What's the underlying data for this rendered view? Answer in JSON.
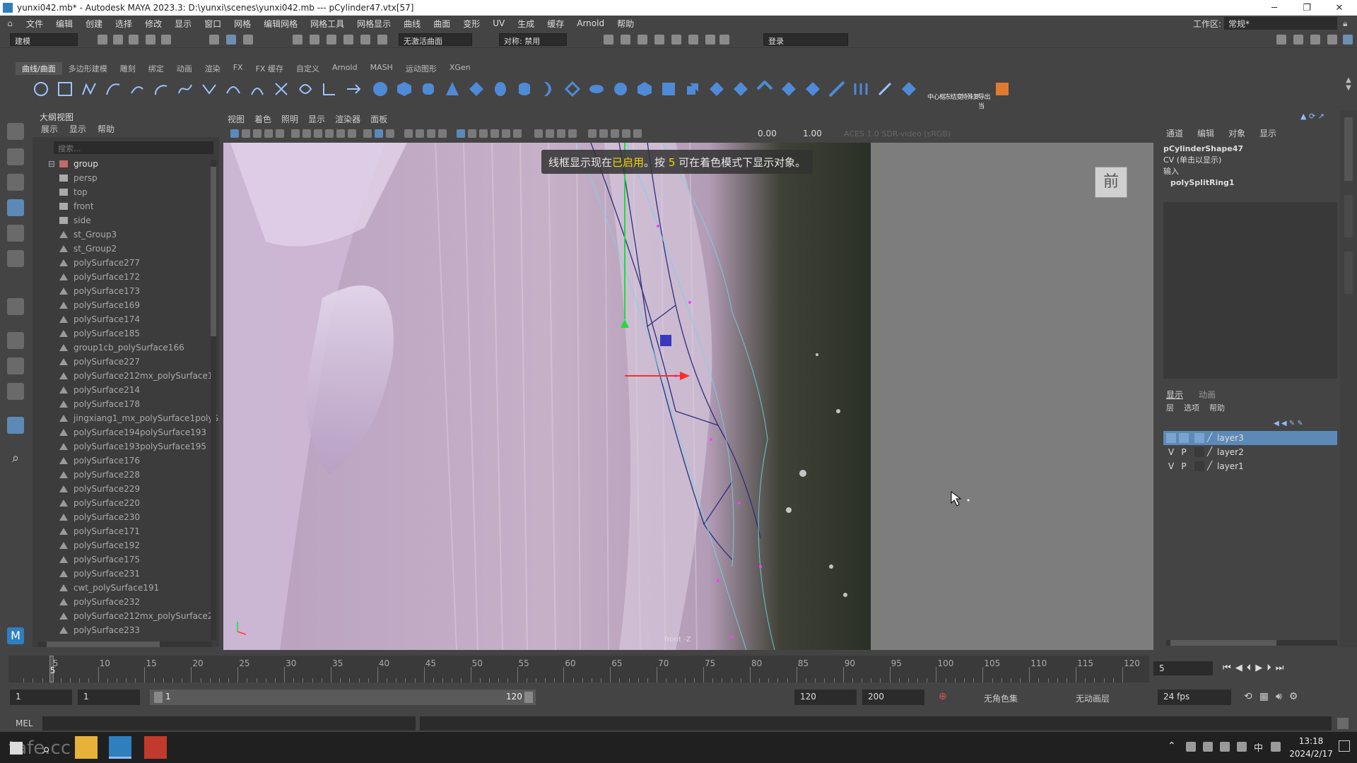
{
  "window": {
    "title": "yunxi042.mb* - Autodesk MAYA 2023.3: D:\\yunxi\\scenes\\yunxi042.mb   ---   pCylinder47.vtx[57]",
    "minimize": "─",
    "maximize": "❐",
    "close": "✕"
  },
  "menubar": [
    "文件",
    "编辑",
    "创建",
    "选择",
    "修改",
    "显示",
    "窗口",
    "网格",
    "编辑网格",
    "网格工具",
    "网格显示",
    "曲线",
    "曲面",
    "变形",
    "UV",
    "生成",
    "缓存",
    "Arnold",
    "帮助"
  ],
  "workspace": {
    "label": "工作区:",
    "value": "常规*"
  },
  "statusline": {
    "mode": "建模",
    "live_surface": "无激活曲面",
    "symmetry": "对称: 禁用",
    "login": "登录"
  },
  "shelf": {
    "tabs": [
      "曲线/曲面",
      "多边形建模",
      "雕刻",
      "绑定",
      "动画",
      "渲染",
      "FX",
      "FX 缓存",
      "自定义",
      "Arnold",
      "MASH",
      "运动图形",
      "XGen"
    ],
    "active": "曲线/曲面",
    "labels": [
      "中心枢",
      "冻结变",
      "特殊复",
      "导出当"
    ]
  },
  "outliner": {
    "title": "大纲视图",
    "menu": [
      "展示",
      "显示",
      "帮助"
    ],
    "search_placeholder": "搜索...",
    "items": [
      {
        "label": "group",
        "type": "group"
      },
      {
        "label": "persp",
        "type": "camera"
      },
      {
        "label": "top",
        "type": "camera"
      },
      {
        "label": "front",
        "type": "camera"
      },
      {
        "label": "side",
        "type": "camera"
      },
      {
        "label": "st_Group3",
        "type": "mesh"
      },
      {
        "label": "st_Group2",
        "type": "mesh"
      },
      {
        "label": "polySurface277",
        "type": "mesh"
      },
      {
        "label": "polySurface172",
        "type": "mesh"
      },
      {
        "label": "polySurface173",
        "type": "mesh"
      },
      {
        "label": "polySurface169",
        "type": "mesh"
      },
      {
        "label": "polySurface174",
        "type": "mesh"
      },
      {
        "label": "polySurface185",
        "type": "mesh"
      },
      {
        "label": "group1cb_polySurface166",
        "type": "mesh"
      },
      {
        "label": "polySurface227",
        "type": "mesh"
      },
      {
        "label": "polySurface212mx_polySurface1",
        "type": "mesh"
      },
      {
        "label": "polySurface214",
        "type": "mesh"
      },
      {
        "label": "polySurface178",
        "type": "mesh"
      },
      {
        "label": "jingxiang1_mx_polySurface1polyS",
        "type": "mesh"
      },
      {
        "label": "polySurface194polySurface193",
        "type": "mesh"
      },
      {
        "label": "polySurface193polySurface195",
        "type": "mesh"
      },
      {
        "label": "polySurface176",
        "type": "mesh"
      },
      {
        "label": "polySurface228",
        "type": "mesh"
      },
      {
        "label": "polySurface229",
        "type": "mesh"
      },
      {
        "label": "polySurface220",
        "type": "mesh"
      },
      {
        "label": "polySurface230",
        "type": "mesh"
      },
      {
        "label": "polySurface171",
        "type": "mesh"
      },
      {
        "label": "polySurface192",
        "type": "mesh"
      },
      {
        "label": "polySurface175",
        "type": "mesh"
      },
      {
        "label": "polySurface231",
        "type": "mesh"
      },
      {
        "label": "cwt_polySurface191",
        "type": "mesh"
      },
      {
        "label": "polySurface232",
        "type": "mesh"
      },
      {
        "label": "polySurface212mx_polySurface2",
        "type": "mesh"
      },
      {
        "label": "polySurface233",
        "type": "mesh"
      }
    ]
  },
  "viewport": {
    "menu": [
      "视图",
      "着色",
      "照明",
      "显示",
      "渲染器",
      "面板"
    ],
    "exposure": "0.00",
    "gamma": "1.00",
    "colorspace": "ACES 1.0 SDR-video (sRGB)",
    "hint_pre": "线框显示现在",
    "hint_hl1": "已启用",
    "hint_mid": "。按 ",
    "hint_hl2": "5",
    "hint_post": " 可在着色模式下显示对象。",
    "view_cube": "前",
    "camera_label": "front -Z"
  },
  "channelbox": {
    "menu": [
      "通道",
      "编辑",
      "对象",
      "显示"
    ],
    "shape": "pCylinderShape47",
    "cv_note": "CV (单击以显示)",
    "inputs_label": "输入",
    "input_node": "polySplitRing1"
  },
  "layers": {
    "tabs": [
      "显示",
      "动画"
    ],
    "menu": [
      "层",
      "选项",
      "帮助"
    ],
    "rows": [
      {
        "v": "",
        "p": "",
        "name": "layer3",
        "selected": true
      },
      {
        "v": "V",
        "p": "P",
        "name": "layer2",
        "selected": false
      },
      {
        "v": "V",
        "p": "P",
        "name": "layer1",
        "selected": false
      }
    ]
  },
  "timeslider": {
    "ticks": [
      "5",
      "10",
      "15",
      "20",
      "25",
      "30",
      "35",
      "40",
      "45",
      "50",
      "55",
      "60",
      "65",
      "70",
      "75",
      "80",
      "85",
      "90",
      "95",
      "100",
      "105",
      "110",
      "115",
      "120"
    ],
    "current_frame": "5"
  },
  "range": {
    "start": "1",
    "anim_start": "1",
    "slider_start": "1",
    "slider_end": "120",
    "end": "120",
    "anim_end": "200",
    "char_set": "无角色集",
    "anim_layer": "无动画层",
    "fps": "24 fps"
  },
  "cmdline": {
    "label": "MEL"
  },
  "taskbar": {
    "time": "13:18",
    "date": "2024/2/17",
    "ime": "中",
    "watermark": "tafe.cc"
  }
}
